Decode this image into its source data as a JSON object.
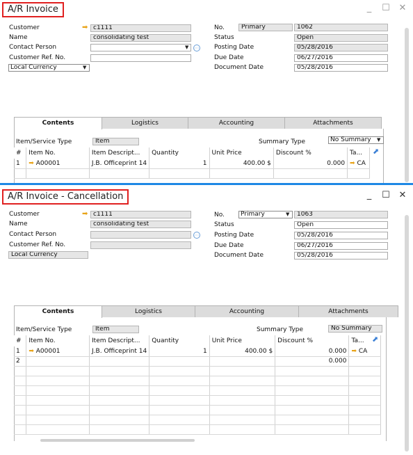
{
  "win1": {
    "title": "A/R Invoice",
    "controls": {
      "min": "_",
      "max": "☐",
      "close": "✕"
    },
    "left": {
      "customer_label": "Customer",
      "customer_value": "c1111",
      "name_label": "Name",
      "name_value": "consolidating test",
      "contact_label": "Contact Person",
      "contact_value": "",
      "ref_label": "Customer Ref. No.",
      "ref_value": "",
      "currency_value": "Local Currency"
    },
    "right": {
      "no_label": "No.",
      "series_value": "Primary",
      "no_value": "1062",
      "status_label": "Status",
      "status_value": "Open",
      "posting_label": "Posting Date",
      "posting_value": "05/28/2016",
      "due_label": "Due Date",
      "due_value": "06/27/2016",
      "docdate_label": "Document Date",
      "docdate_value": "05/28/2016"
    },
    "tabs": [
      "Contents",
      "Logistics",
      "Accounting",
      "Attachments"
    ],
    "item_type_label": "Item/Service Type",
    "item_type_value": "Item",
    "summary_label": "Summary Type",
    "summary_value": "No Summary",
    "columns": [
      "#",
      "Item No.",
      "Item Descript...",
      "Quantity",
      "Unit Price",
      "Discount %",
      "Ta..."
    ],
    "rows": [
      {
        "num": "1",
        "item": "A00001",
        "desc": "J.B. Officeprint 14",
        "qty": "1",
        "price": "400.00 $",
        "disc": "0.000",
        "tax": "CA"
      }
    ]
  },
  "win2": {
    "title": "A/R Invoice - Cancellation",
    "controls": {
      "min": "_",
      "max": "☐",
      "close": "✕"
    },
    "left": {
      "customer_label": "Customer",
      "customer_value": "c1111",
      "name_label": "Name",
      "name_value": "consolidating test",
      "contact_label": "Contact Person",
      "contact_value": "",
      "ref_label": "Customer Ref. No.",
      "ref_value": "",
      "currency_value": "Local Currency"
    },
    "right": {
      "no_label": "No.",
      "series_value": "Primary",
      "no_value": "1063",
      "status_label": "Status",
      "status_value": "Open",
      "posting_label": "Posting Date",
      "posting_value": "05/28/2016",
      "due_label": "Due Date",
      "due_value": "06/27/2016",
      "docdate_label": "Document Date",
      "docdate_value": "05/28/2016"
    },
    "tabs": [
      "Contents",
      "Logistics",
      "Accounting",
      "Attachments"
    ],
    "item_type_label": "Item/Service Type",
    "item_type_value": "Item",
    "summary_label": "Summary Type",
    "summary_value": "No Summary",
    "columns": [
      "#",
      "Item No.",
      "Item Descript...",
      "Quantity",
      "Unit Price",
      "Discount %",
      "Ta..."
    ],
    "rows": [
      {
        "num": "1",
        "item": "A00001",
        "desc": "J.B. Officeprint 14",
        "qty": "1",
        "price": "400.00 $",
        "disc": "0.000",
        "tax": "CA"
      },
      {
        "num": "2",
        "item": "",
        "desc": "",
        "qty": "",
        "price": "",
        "disc": "0.000",
        "tax": ""
      }
    ]
  }
}
